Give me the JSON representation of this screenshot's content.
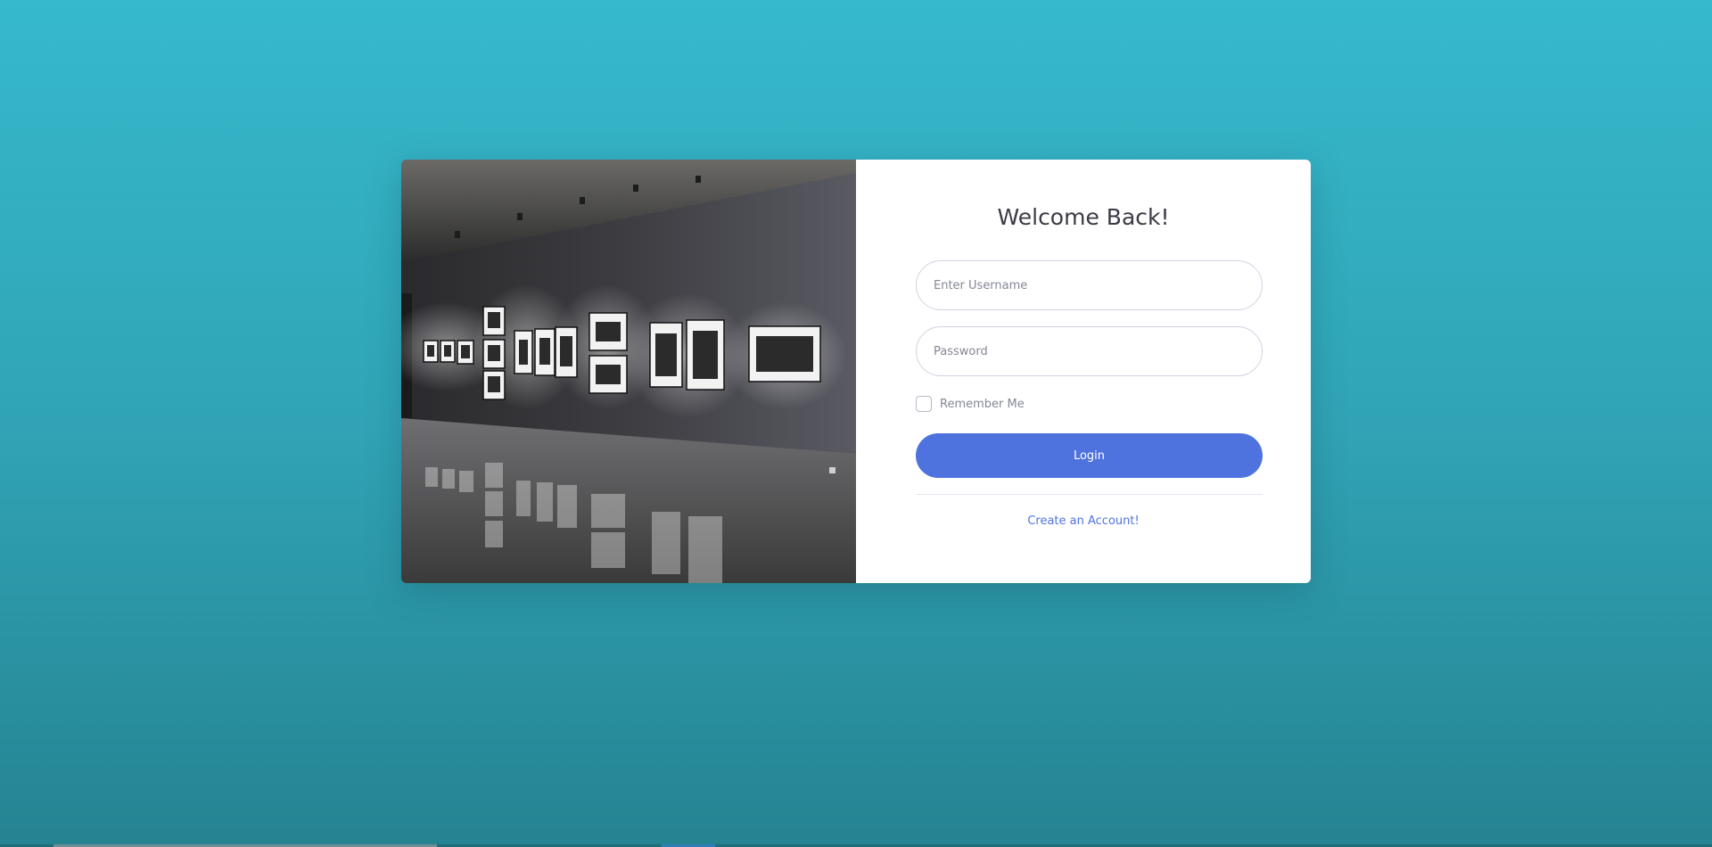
{
  "login": {
    "title": "Welcome Back!",
    "username_placeholder": "Enter Username",
    "password_placeholder": "Password",
    "remember_label": "Remember Me",
    "remember_checked": false,
    "login_label": "Login",
    "create_account_label": "Create an Account!"
  },
  "colors": {
    "background_top": "#36b9cc",
    "background_bottom": "#258391",
    "primary": "#4e73df",
    "title_text": "#3a3b45",
    "muted_text": "#858796"
  },
  "image": {
    "subject": "photo-gallery-wall-with-framed-black-and-white-photographs"
  }
}
